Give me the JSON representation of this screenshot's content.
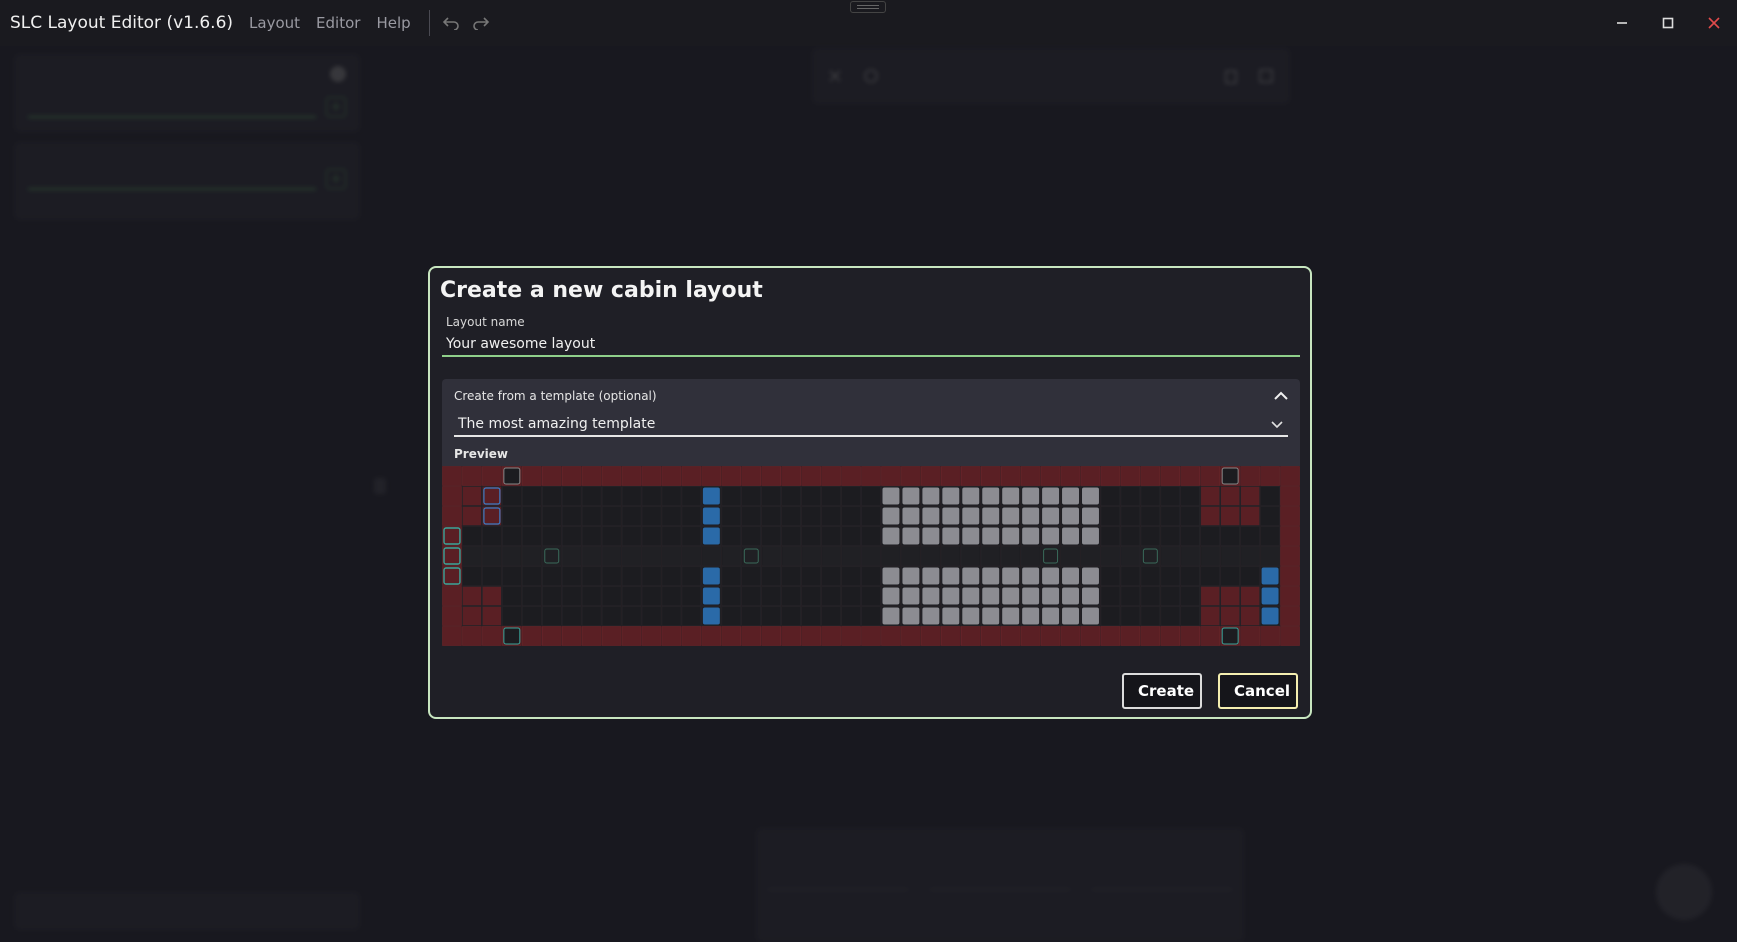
{
  "window": {
    "title": "SLC Layout Editor (v1.6.6)",
    "menu": [
      "Layout",
      "Editor",
      "Help"
    ],
    "icons": [
      "undo-icon",
      "redo-icon",
      "minimize-icon",
      "maximize-icon",
      "close-icon"
    ]
  },
  "dialog": {
    "title": "Create a new cabin layout",
    "name_label": "Layout name",
    "name_value": "Your awesome layout",
    "template_label": "Create from a template (optional)",
    "template_value": "The most amazing template",
    "preview_label": "Preview",
    "create_label": "Create",
    "cancel_label": "Cancel",
    "accent_color": "#c8e6c0",
    "cancel_border_color": "#f4eeb0"
  }
}
